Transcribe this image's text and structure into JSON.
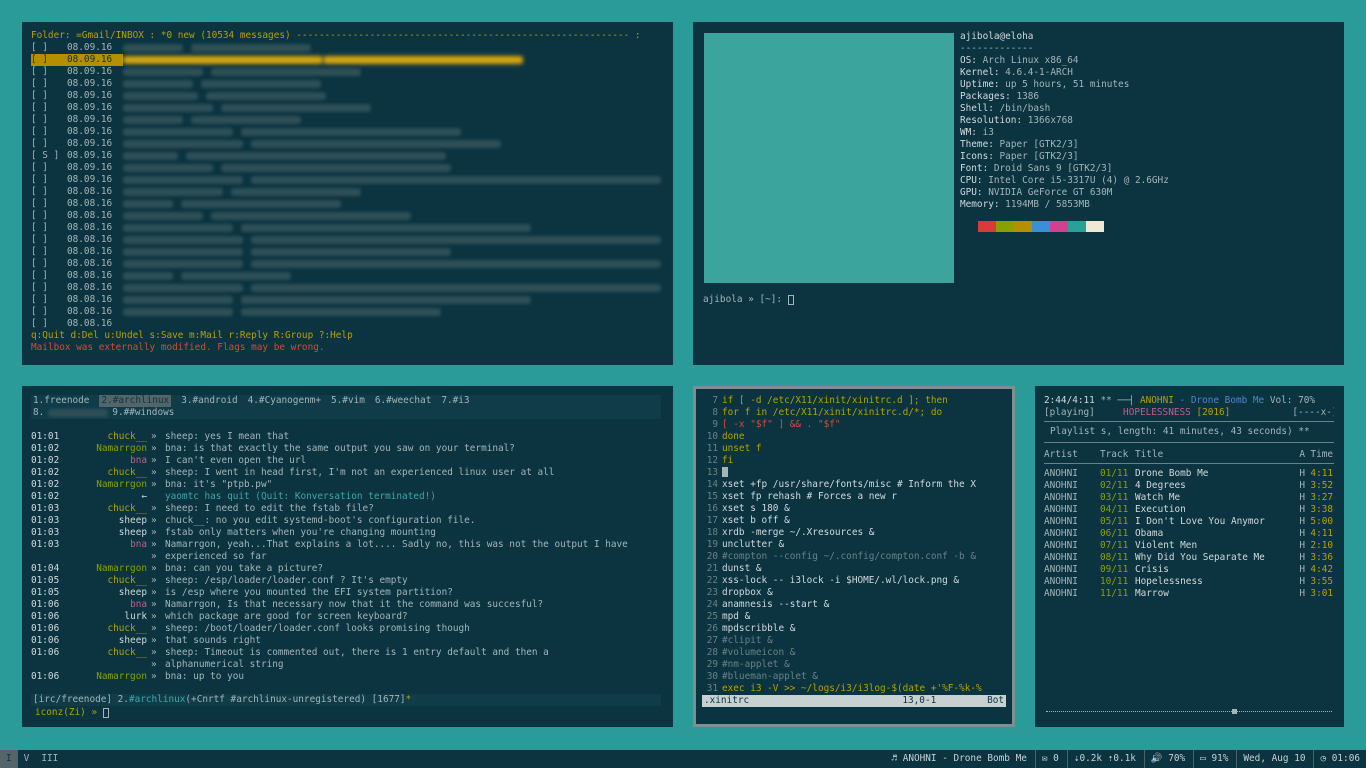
{
  "mail": {
    "header": "Folder: =Gmail/INBOX : *0 new (10534 messages) ----------------------------------------------------------- :",
    "rows": [
      {
        "flag": "[  ]",
        "date": "08.09.16",
        "w": [
          60,
          120
        ]
      },
      {
        "flag": "[  ]",
        "date": "08.09.16",
        "w": [
          200,
          200
        ],
        "sel": true
      },
      {
        "flag": "[  ]",
        "date": "08.09.16",
        "w": [
          80,
          150
        ]
      },
      {
        "flag": "[  ]",
        "date": "08.09.16",
        "w": [
          70,
          120
        ]
      },
      {
        "flag": "[  ]",
        "date": "08.09.16",
        "w": [
          75,
          120
        ]
      },
      {
        "flag": "[  ]",
        "date": "08.09.16",
        "w": [
          90,
          150
        ]
      },
      {
        "flag": "[  ]",
        "date": "08.09.16",
        "w": [
          60,
          110
        ]
      },
      {
        "flag": "[  ]",
        "date": "08.09.16",
        "w": [
          110,
          220
        ]
      },
      {
        "flag": "[  ]",
        "date": "08.09.16",
        "w": [
          120,
          250
        ]
      },
      {
        "flag": "[ S ]",
        "date": "08.09.16",
        "w": [
          55,
          260
        ]
      },
      {
        "flag": "[  ]",
        "date": "08.09.16",
        "w": [
          90,
          230
        ]
      },
      {
        "flag": "[  ]",
        "date": "08.09.16",
        "w": [
          120,
          410
        ]
      },
      {
        "flag": "[  ]",
        "date": "08.08.16",
        "w": [
          100,
          130
        ]
      },
      {
        "flag": "[  ]",
        "date": "08.08.16",
        "w": [
          50,
          160
        ]
      },
      {
        "flag": "[  ]",
        "date": "08.08.16",
        "w": [
          80,
          200
        ]
      },
      {
        "flag": "[  ]",
        "date": "08.08.16",
        "w": [
          110,
          290
        ]
      },
      {
        "flag": "[  ]",
        "date": "08.08.16",
        "w": [
          120,
          410
        ]
      },
      {
        "flag": "[  ]",
        "date": "08.08.16",
        "w": [
          120,
          200
        ]
      },
      {
        "flag": "[  ]",
        "date": "08.08.16",
        "w": [
          120,
          410
        ]
      },
      {
        "flag": "[  ]",
        "date": "08.08.16",
        "w": [
          50,
          110
        ]
      },
      {
        "flag": "[  ]",
        "date": "08.08.16",
        "w": [
          120,
          410
        ]
      },
      {
        "flag": "[  ]",
        "date": "08.08.16",
        "w": [
          110,
          290
        ]
      },
      {
        "flag": "[  ]",
        "date": "08.08.16",
        "w": [
          110,
          200
        ]
      },
      {
        "flag": "[  ]",
        "date": "08.08.16",
        "w": [
          0,
          0
        ]
      }
    ],
    "help": "q:Quit  d:Del  u:Undel  s:Save  m:Mail  r:Reply  R:Group  ?:Help",
    "warn": "Mailbox was externally modified.  Flags may be wrong."
  },
  "sys": {
    "user": "ajibola@eloha",
    "sep": "-------------",
    "lines": [
      [
        "OS:",
        "Arch Linux x86_64"
      ],
      [
        "Kernel:",
        "4.6.4-1-ARCH"
      ],
      [
        "Uptime:",
        "up 5 hours, 51 minutes"
      ],
      [
        "Packages:",
        "1386"
      ],
      [
        "Shell:",
        "/bin/bash"
      ],
      [
        "Resolution:",
        "1366x768"
      ],
      [
        "WM:",
        "i3"
      ],
      [
        "Theme:",
        "Paper [GTK2/3]"
      ],
      [
        "Icons:",
        "Paper [GTK2/3]"
      ],
      [
        "Font:",
        "Droid Sans 9 [GTK2/3]"
      ],
      [
        "CPU:",
        "Intel Core i5-3317U (4) @ 2.6GHz"
      ],
      [
        "GPU:",
        "NVIDIA GeForce GT 630M"
      ],
      [
        "Memory:",
        "1194MB / 5853MB"
      ]
    ],
    "swatches": [
      "#0b3440",
      "#d93a3a",
      "#8aa000",
      "#b58f00",
      "#3a8fd9",
      "#d3408f",
      "#2aa198",
      "#eee8d5"
    ],
    "prompt": "ajibola » [~]:"
  },
  "irc": {
    "tabs": [
      {
        "label": "1.freenode"
      },
      {
        "label": "2.#archlinux",
        "act": true
      },
      {
        "label": "3.#android"
      },
      {
        "label": "4.#Cyanogenm+"
      },
      {
        "label": "5.#vim"
      },
      {
        "label": "6.#weechat"
      },
      {
        "label": "7.#i3"
      }
    ],
    "tabs2": [
      "8.",
      "9.##windows"
    ],
    "msgs": [
      {
        "t": "01:01",
        "n": "chuck__",
        "c": "y",
        "x": "sheep: yes I mean that"
      },
      {
        "t": "01:02",
        "n": "Namarrgon",
        "c": "g",
        "x": "bna: is that exactly the same output you saw on your terminal?"
      },
      {
        "t": "01:02",
        "n": "bna",
        "c": "m",
        "x": "I can't even open the url"
      },
      {
        "t": "01:02",
        "n": "chuck__",
        "c": "y",
        "x": "sheep: I went in head first, I'm not an experienced linux user at all"
      },
      {
        "t": "01:02",
        "n": "Namarrgon",
        "c": "g",
        "x": "bna: it's \"ptpb.pw\""
      },
      {
        "t": "01:02",
        "n": "←",
        "c": "w",
        "x": "yaomtc has quit (Quit: Konversation terminated!)",
        "s": "—"
      },
      {
        "t": "01:03",
        "n": "chuck__",
        "c": "y",
        "x": "sheep: I need to edit the fstab file?"
      },
      {
        "t": "01:03",
        "n": "sheep",
        "c": "w",
        "x": "chuck__: no you edit systemd-boot's configuration file."
      },
      {
        "t": "01:03",
        "n": "sheep",
        "c": "w",
        "x": "fstab only matters when you're changing mounting"
      },
      {
        "t": "01:03",
        "n": "bna",
        "c": "m",
        "x": "Namarrgon, yeah...That explains a lot.... Sadly no, this was not the output I have"
      },
      {
        "t": "",
        "n": "",
        "c": "w",
        "x": "experienced so far"
      },
      {
        "t": "01:04",
        "n": "Namarrgon",
        "c": "g",
        "x": "bna: can you take a picture?"
      },
      {
        "t": "01:05",
        "n": "chuck__",
        "c": "y",
        "x": "sheep: /esp/loader/loader.conf ? It's empty"
      },
      {
        "t": "01:05",
        "n": "sheep",
        "c": "w",
        "x": "is /esp where you mounted the EFI system partition?"
      },
      {
        "t": "01:06",
        "n": "bna",
        "c": "m",
        "x": "Namarrgon, Is that necessary now that it the command was succesful?"
      },
      {
        "t": "01:06",
        "n": "lurk",
        "c": "w",
        "x": "which package are good for screen keyboard?"
      },
      {
        "t": "01:06",
        "n": "chuck__",
        "c": "y",
        "x": "sheep: /boot/loader/loader.conf looks promising though"
      },
      {
        "t": "01:06",
        "n": "sheep",
        "c": "w",
        "x": "that sounds right"
      },
      {
        "t": "01:06",
        "n": "chuck__",
        "c": "y",
        "x": "sheep: Timeout is commented out, there is 1 entry default and then a"
      },
      {
        "t": "",
        "n": "",
        "c": "w",
        "x": "alphanumerical string"
      },
      {
        "t": "01:06",
        "n": "Namarrgon",
        "c": "g",
        "x": "bna: up to you"
      }
    ],
    "status_a": "[irc/freenode]  2.",
    "status_b": "#archlinux",
    "status_c": "(+Cnrtf #archlinux-unregistered)  [1677]",
    "status_d": "*",
    "input": "iconz(Zi) »"
  },
  "vim": {
    "lines": [
      [
        "7",
        "if [ -d /etc/X11/xinit/xinitrc.d ]; then",
        "y"
      ],
      [
        "8",
        "  for f in /etc/X11/xinit/xinitrc.d/*; do",
        "y"
      ],
      [
        "9",
        "    [ -x \"$f\" ] && . \"$f\"",
        "r"
      ],
      [
        "10",
        "  done",
        "y"
      ],
      [
        "11",
        "  unset f",
        "y"
      ],
      [
        "12",
        "fi",
        "y"
      ],
      [
        "13",
        "",
        ""
      ],
      [
        "14",
        "xset +fp /usr/share/fonts/misc # Inform the X",
        "w"
      ],
      [
        "15",
        "xset fp rehash                  # Forces a new r",
        "w"
      ],
      [
        "16",
        "xset s 180 &",
        "w"
      ],
      [
        "17",
        "xset b off &",
        "w"
      ],
      [
        "18",
        "xrdb -merge ~/.Xresources &",
        "w"
      ],
      [
        "19",
        "unclutter &",
        "w"
      ],
      [
        "20",
        "#compton --config ~/.config/compton.conf -b &",
        "dim"
      ],
      [
        "21",
        "dunst &",
        "w"
      ],
      [
        "22",
        "xss-lock -- i3lock -i $HOME/.wl/lock.png &",
        "w"
      ],
      [
        "23",
        "dropbox &",
        "w"
      ],
      [
        "24",
        "anamnesis --start &",
        "w"
      ],
      [
        "25",
        "mpd &",
        "w"
      ],
      [
        "26",
        "mpdscribble &",
        "w"
      ],
      [
        "27",
        "#clipit &",
        "dim"
      ],
      [
        "28",
        "#volumeicon &",
        "dim"
      ],
      [
        "29",
        "#nm-applet &",
        "dim"
      ],
      [
        "30",
        "#blueman-applet &",
        "dim"
      ],
      [
        "31",
        "exec i3 -V >> ~/logs/i3/i3log-$(date +'%F-%k-%",
        "y"
      ]
    ],
    "file": ".xinitrc",
    "pos": "13,0-1",
    "scroll": "Bot"
  },
  "music": {
    "time": "2:44/4:11",
    "flags": "** ──┤",
    "artist": "ANOHNI",
    "sep": " - ",
    "song": "Drone Bomb Me",
    "vol": "Vol: 70%",
    "state": "[playing]",
    "album": "HOPELESSNESS",
    "year": "[2016]",
    "mode": "[----x-]",
    "playlist": "Playlist s, length: 41 minutes, 43 seconds) **",
    "cols": [
      "Artist",
      "Track",
      "Title",
      "A",
      "Time"
    ],
    "tracks": [
      [
        "ANOHNI",
        "01/11",
        "Drone Bomb Me",
        "H",
        "4:11"
      ],
      [
        "ANOHNI",
        "02/11",
        "4 Degrees",
        "H",
        "3:52"
      ],
      [
        "ANOHNI",
        "03/11",
        "Watch Me",
        "H",
        "3:27"
      ],
      [
        "ANOHNI",
        "04/11",
        "Execution",
        "H",
        "3:38"
      ],
      [
        "ANOHNI",
        "05/11",
        "I Don't Love You Anymor",
        "H",
        "5:00"
      ],
      [
        "ANOHNI",
        "06/11",
        "Obama",
        "H",
        "4:11"
      ],
      [
        "ANOHNI",
        "07/11",
        "Violent Men",
        "H",
        "2:10"
      ],
      [
        "ANOHNI",
        "08/11",
        "Why Did You Separate Me",
        "H",
        "3:36"
      ],
      [
        "ANOHNI",
        "09/11",
        "Crisis",
        "H",
        "4:42"
      ],
      [
        "ANOHNI",
        "10/11",
        "Hopelessness",
        "H",
        "3:55"
      ],
      [
        "ANOHNI",
        "11/11",
        "Marrow",
        "H",
        "3:01"
      ]
    ],
    "progress": 0.65
  },
  "bar": {
    "workspaces": [
      {
        "label": "I",
        "act": true
      },
      {
        "label": "V"
      },
      {
        "label": "III"
      }
    ],
    "now": "♬ ANOHNI - Drone Bomb Me",
    "mail": "✉ 0",
    "net": "⇣0.2k ⇡0.1k",
    "vol": "🔊 70%",
    "bat": "▭ 91%",
    "date": "Wed, Aug 10",
    "clock": "◷ 01:06"
  }
}
